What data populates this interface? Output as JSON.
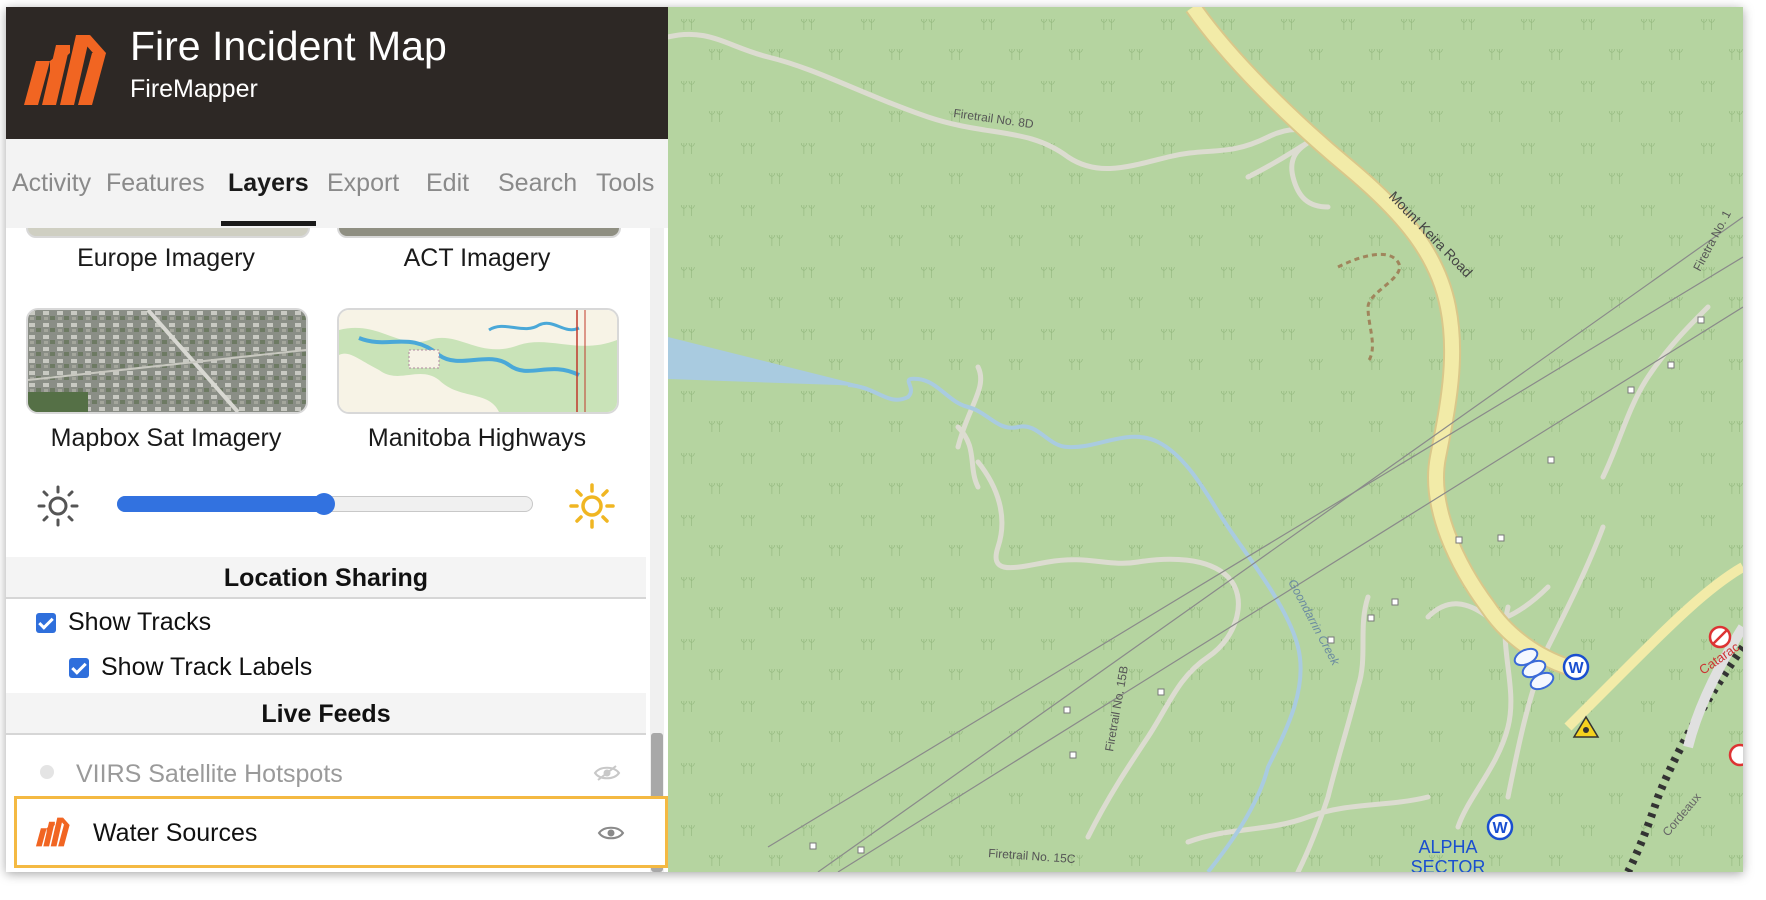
{
  "header": {
    "title": "Fire Incident Map",
    "subtitle": "FireMapper"
  },
  "tabs": [
    {
      "label": "Activity"
    },
    {
      "label": "Features"
    },
    {
      "label": "Layers"
    },
    {
      "label": "Export"
    },
    {
      "label": "Edit"
    },
    {
      "label": "Search"
    },
    {
      "label": "Tools"
    }
  ],
  "active_tab": "Layers",
  "basemaps": [
    {
      "label": "Europe Imagery"
    },
    {
      "label": "ACT Imagery"
    },
    {
      "label": "Mapbox Sat Imagery"
    },
    {
      "label": "Manitoba Highways"
    }
  ],
  "brightness": {
    "value_fraction": 0.5,
    "low_icon": "sun-dim-icon",
    "high_icon": "sun-bright-icon"
  },
  "location_sharing": {
    "heading": "Location Sharing",
    "show_tracks": {
      "label": "Show Tracks",
      "checked": true
    },
    "show_track_labels": {
      "label": "Show Track Labels",
      "checked": true
    }
  },
  "live_feeds": {
    "heading": "Live Feeds",
    "items": [
      {
        "label": "VIIRS Satellite Hotspots",
        "visible": false,
        "icon": "eye-slash-icon"
      },
      {
        "label": "Water Sources",
        "visible": true,
        "icon": "eye-icon"
      }
    ]
  },
  "map": {
    "labels": {
      "road_main": "Mount Keira Road",
      "fire_8d": "Firetrail No. 8D",
      "fire_15b": "Firetrail No. 15B",
      "fire_15c": "Firetrail No. 15C",
      "creek": "Goondarrin Creek",
      "fire_right": "Firetra No. 1",
      "cataract": "Catarac",
      "cordeaux": "Cordeaux",
      "sector_1": "ALPHA",
      "sector_2": "SECTOR",
      "water_marker": "W"
    },
    "colors": {
      "background": "#b5d4a0",
      "road": "#f2eba8",
      "water": "#a9cbe0",
      "accent": "#f16522"
    }
  }
}
